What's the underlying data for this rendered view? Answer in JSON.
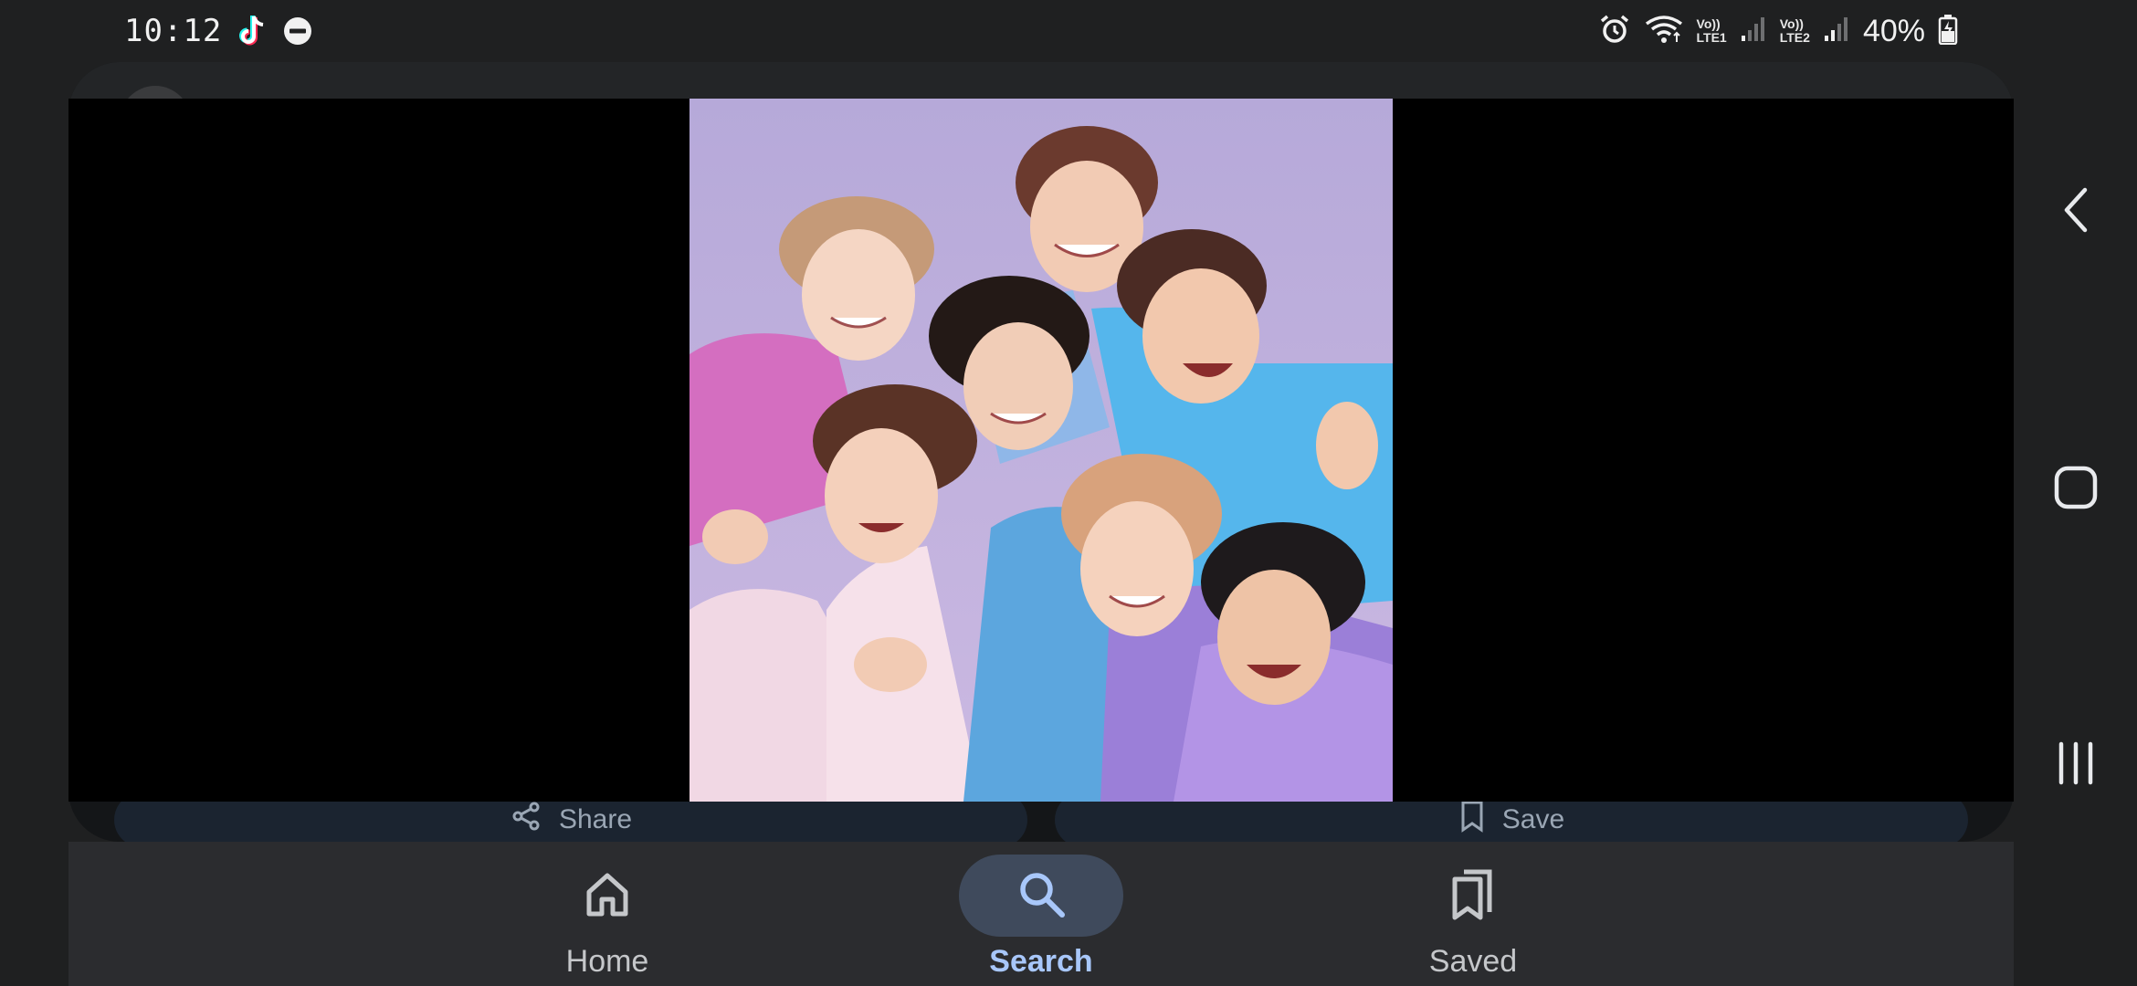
{
  "status_bar": {
    "time": "10:12",
    "sim1_label_top": "Vo))",
    "sim1_label_bottom": "LTE1",
    "sim2_label_top": "Vo))",
    "sim2_label_bottom": "LTE2",
    "battery_percent": "40%",
    "icons": [
      "tiktok-icon",
      "do-not-disturb-icon",
      "alarm-icon",
      "wifi-icon",
      "signal-icon",
      "signal-icon",
      "battery-charging-icon"
    ]
  },
  "card": {
    "share_label": "Share",
    "save_label": "Save"
  },
  "viewer": {
    "image_icon": "group-photo"
  },
  "bottom_nav": {
    "items": [
      {
        "label": "Home",
        "icon": "home-icon"
      },
      {
        "label": "Search",
        "icon": "search-icon",
        "active": true
      },
      {
        "label": "Saved",
        "icon": "saved-icon"
      }
    ]
  },
  "system_nav": {
    "icons": [
      "back-icon",
      "home-button-icon",
      "recents-icon"
    ]
  },
  "colors": {
    "accent": "#a8c7fa",
    "active_pill": "#3f4a5c",
    "nav_background": "#2b2c2f",
    "photo_background": "#c3b6e0"
  }
}
